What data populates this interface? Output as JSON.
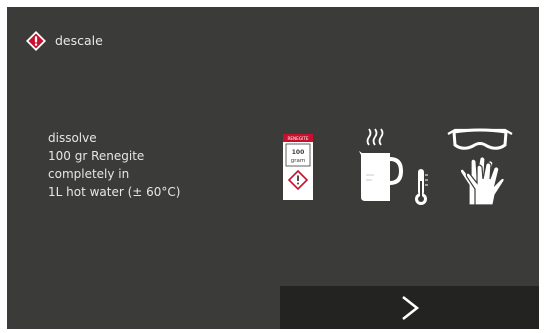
{
  "header": {
    "title": "descale",
    "icon": "warning-diamond-icon"
  },
  "instruction": {
    "lines": [
      "dissolve",
      "100 gr Renegite",
      "completely in",
      "1L hot water (± 60°C)"
    ]
  },
  "package": {
    "brand": "RENEGITE",
    "amount": "100",
    "unit": "gram"
  },
  "icons": [
    "renegite-package-icon",
    "hot-water-jug-icon",
    "thermometer-icon",
    "safety-goggles-icon",
    "protective-gloves-icon"
  ],
  "navigation": {
    "next_label": ">",
    "next_icon": "chevron-right-icon"
  },
  "colors": {
    "screen_background": "#3b3b39",
    "footer_background": "#232322",
    "warning_red": "#c8102e",
    "text": "#e6e6e4"
  }
}
